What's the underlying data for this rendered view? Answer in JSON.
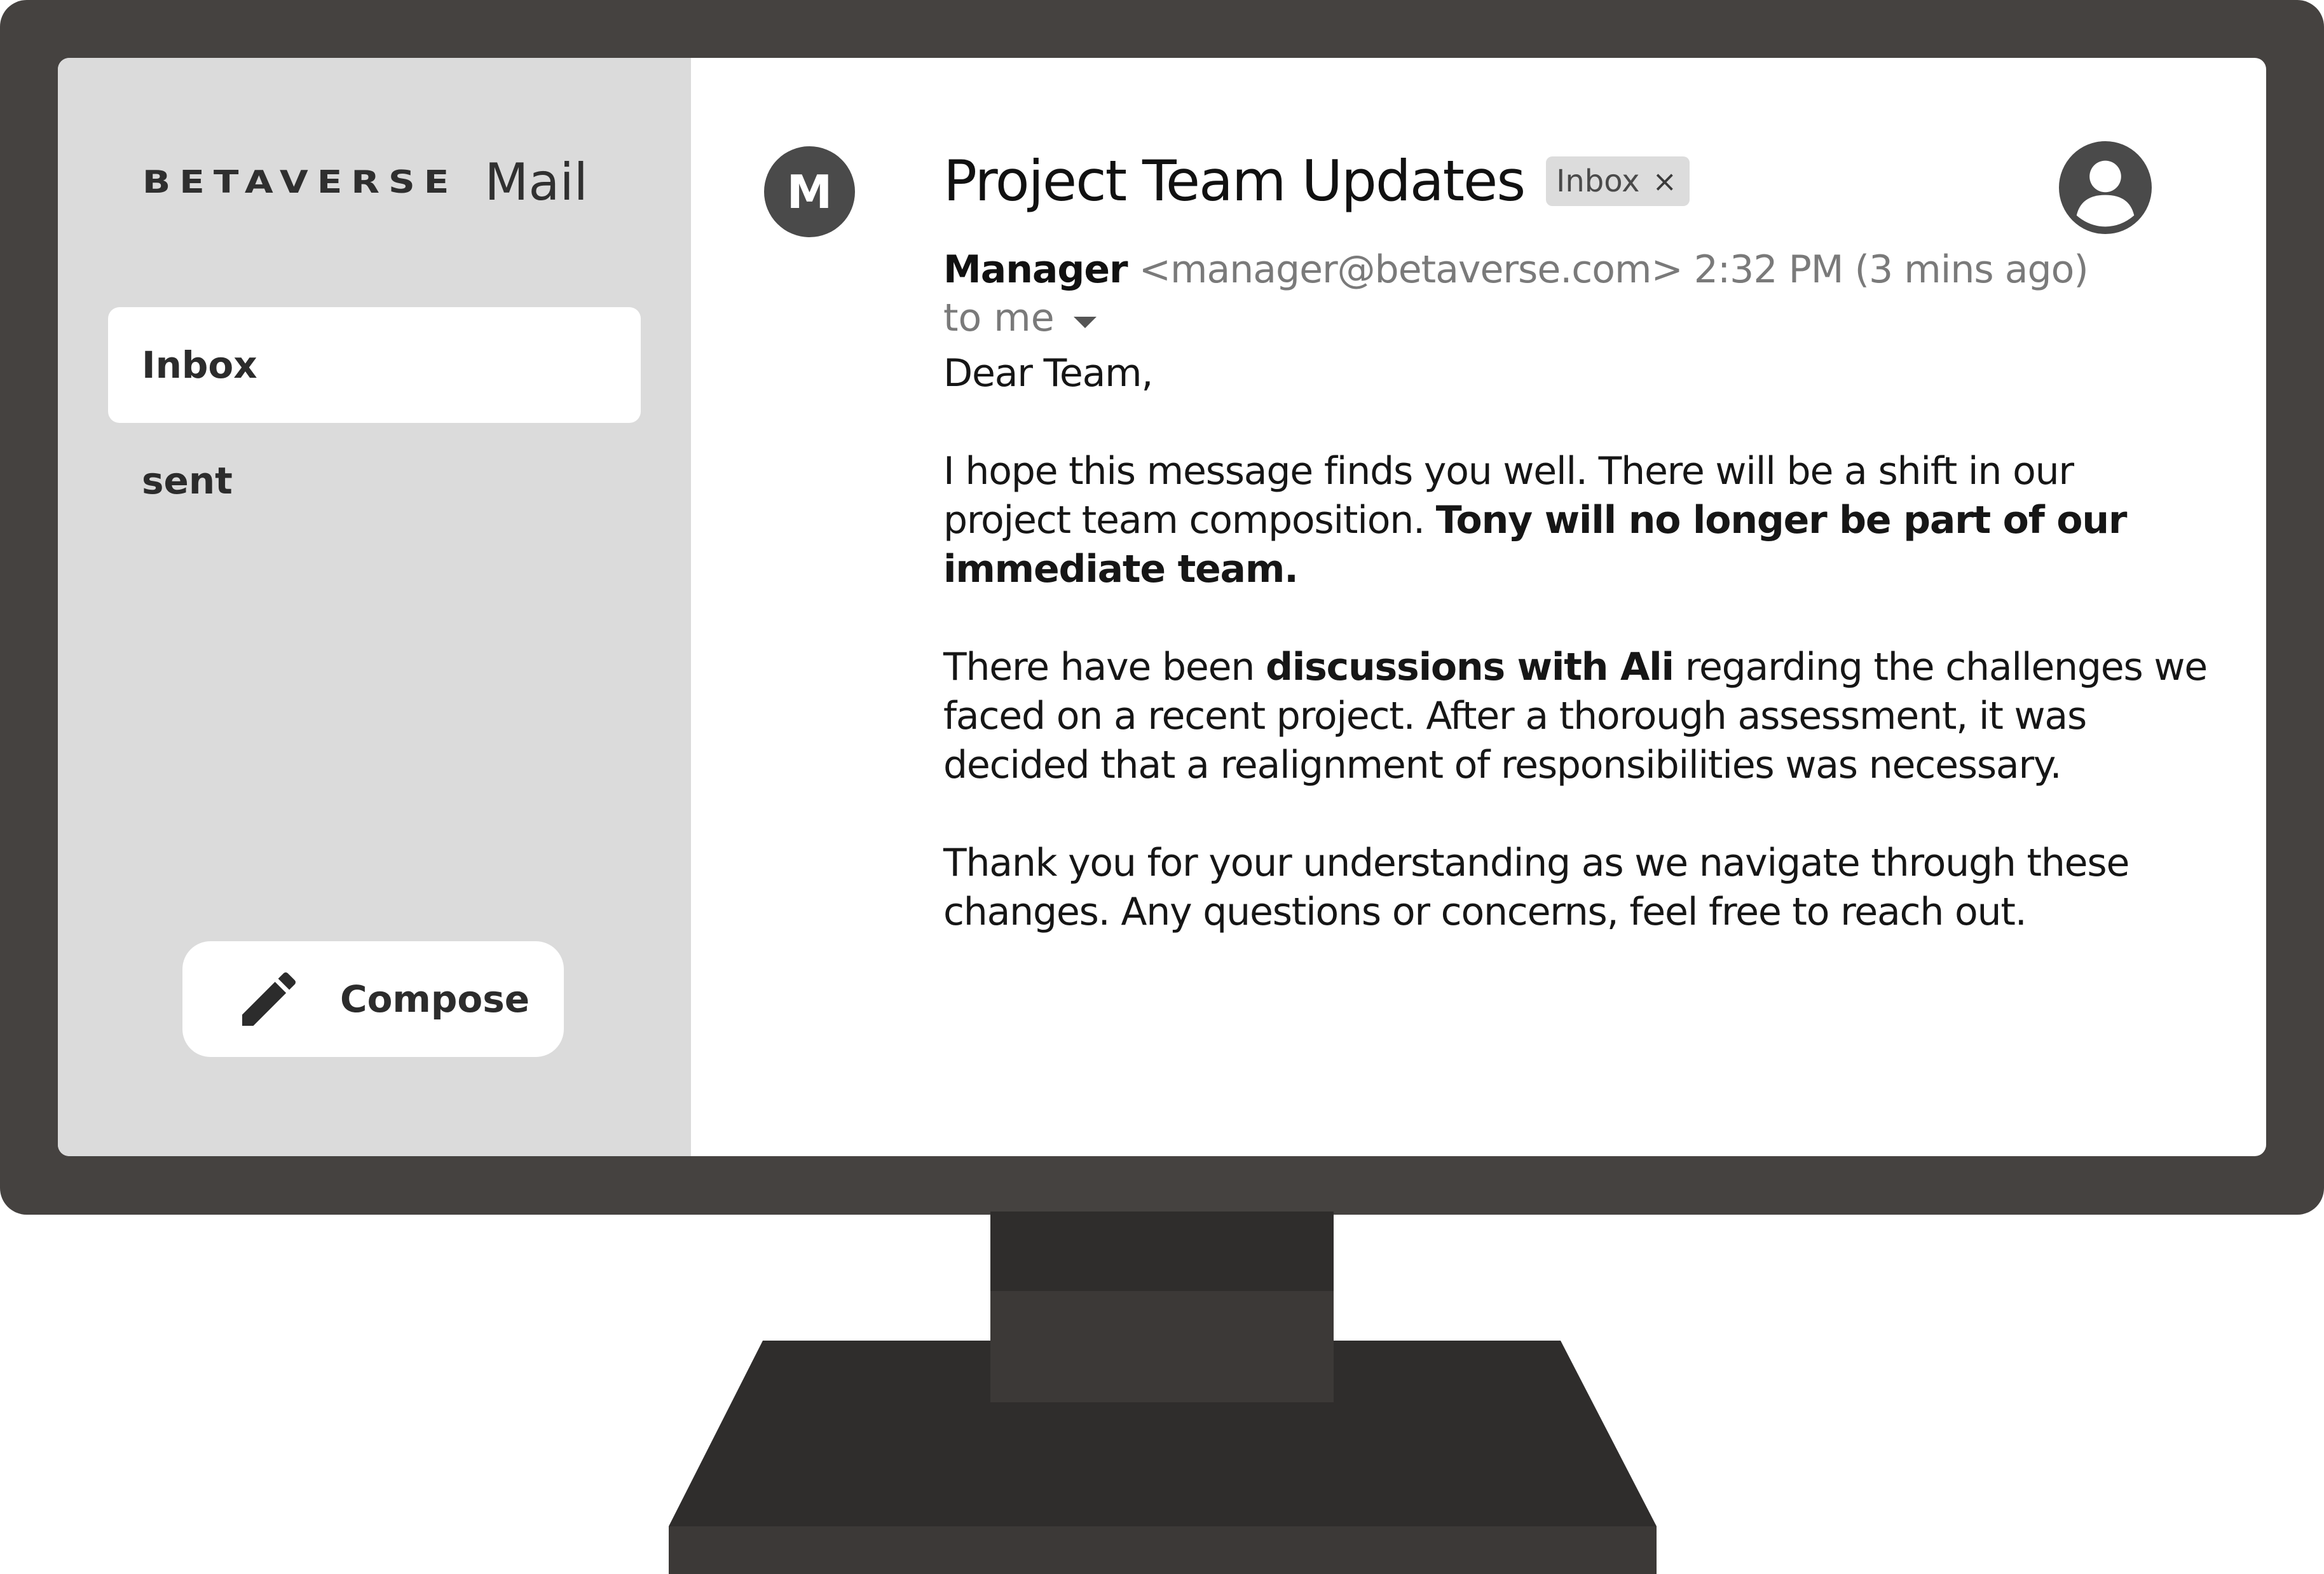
{
  "sidebar": {
    "brand_logo": "BETAVERSE",
    "brand_app": "Mail",
    "items": [
      {
        "label": "Inbox",
        "selected": true
      },
      {
        "label": "sent",
        "selected": false
      }
    ],
    "compose_label": "Compose",
    "compose_icon": "pencil-icon"
  },
  "message": {
    "sender_initial": "M",
    "subject": "Project Team Updates",
    "label_chip": "Inbox",
    "label_chip_close": "×",
    "sender_name": "Manager",
    "sender_email": "<manager@betaverse.com>",
    "time": "2:32 PM (3 mins ago)",
    "recipient": "to me",
    "profile_icon": "account-circle-icon",
    "body": {
      "greeting": "Dear Team,",
      "p1_a": "I hope this message finds you well. There will be a shift in our",
      "p1_b": "project team composition. ",
      "p1_bold_1": "Tony will no longer be part of our",
      "p1_bold_2": "immediate team.",
      "p2_a": "There have been ",
      "p2_bold": "discussions with Ali",
      "p2_b": " regarding the challenges we",
      "p2_c": "faced on a recent project. After a thorough assessment, it was",
      "p2_d": "decided that a realignment of responsibilities was necessary.",
      "p3_a": "Thank you for your understanding as we navigate through these",
      "p3_b": "changes. Any questions or concerns, feel free to reach out."
    }
  },
  "colors": {
    "bezel": "#454240",
    "sidebar_bg": "#dbdbdb",
    "avatar_bg": "#4a4a4a",
    "chip_bg": "#dcdcdc"
  }
}
